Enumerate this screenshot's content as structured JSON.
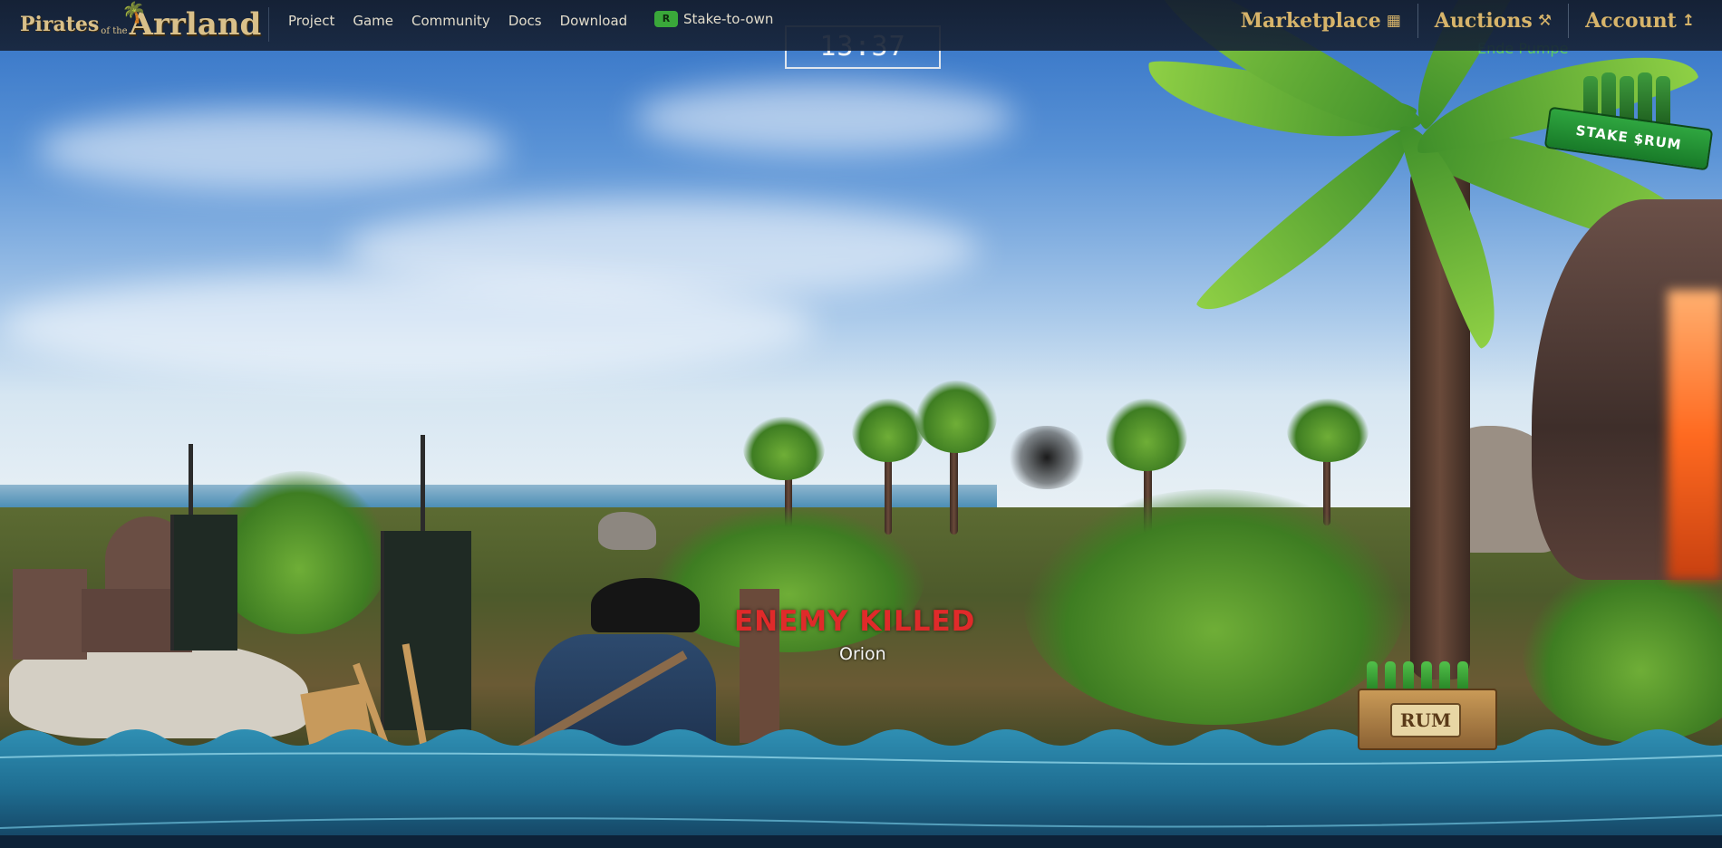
{
  "logo": {
    "line1": "Pirates",
    "line2": "of the",
    "line3": "Arrland"
  },
  "nav": {
    "items": [
      "Project",
      "Game",
      "Community",
      "Docs",
      "Download"
    ],
    "stake_label": "Stake-to-own",
    "stake_icon_text": "R"
  },
  "right_nav": {
    "marketplace": "Marketplace",
    "auctions": "Auctions",
    "account": "Account"
  },
  "game": {
    "timer": "13:37",
    "player_tag": "Ende Pumpe",
    "killfeed_title": "ENEMY KILLED",
    "killfeed_name": "Orion"
  },
  "stake_badge": {
    "text": "STAKE $RUM"
  },
  "rum_crate": {
    "label": "RUM"
  },
  "colors": {
    "nav_bg": "#16223a",
    "gold": "#d7b46a",
    "enemy_red": "#e02a2a",
    "ocean": "#2d8bb0"
  },
  "icons": {
    "marketplace": "basket-icon",
    "auctions": "gavel-icon",
    "account": "arrow-up-icon",
    "stake": "coin-icon"
  }
}
